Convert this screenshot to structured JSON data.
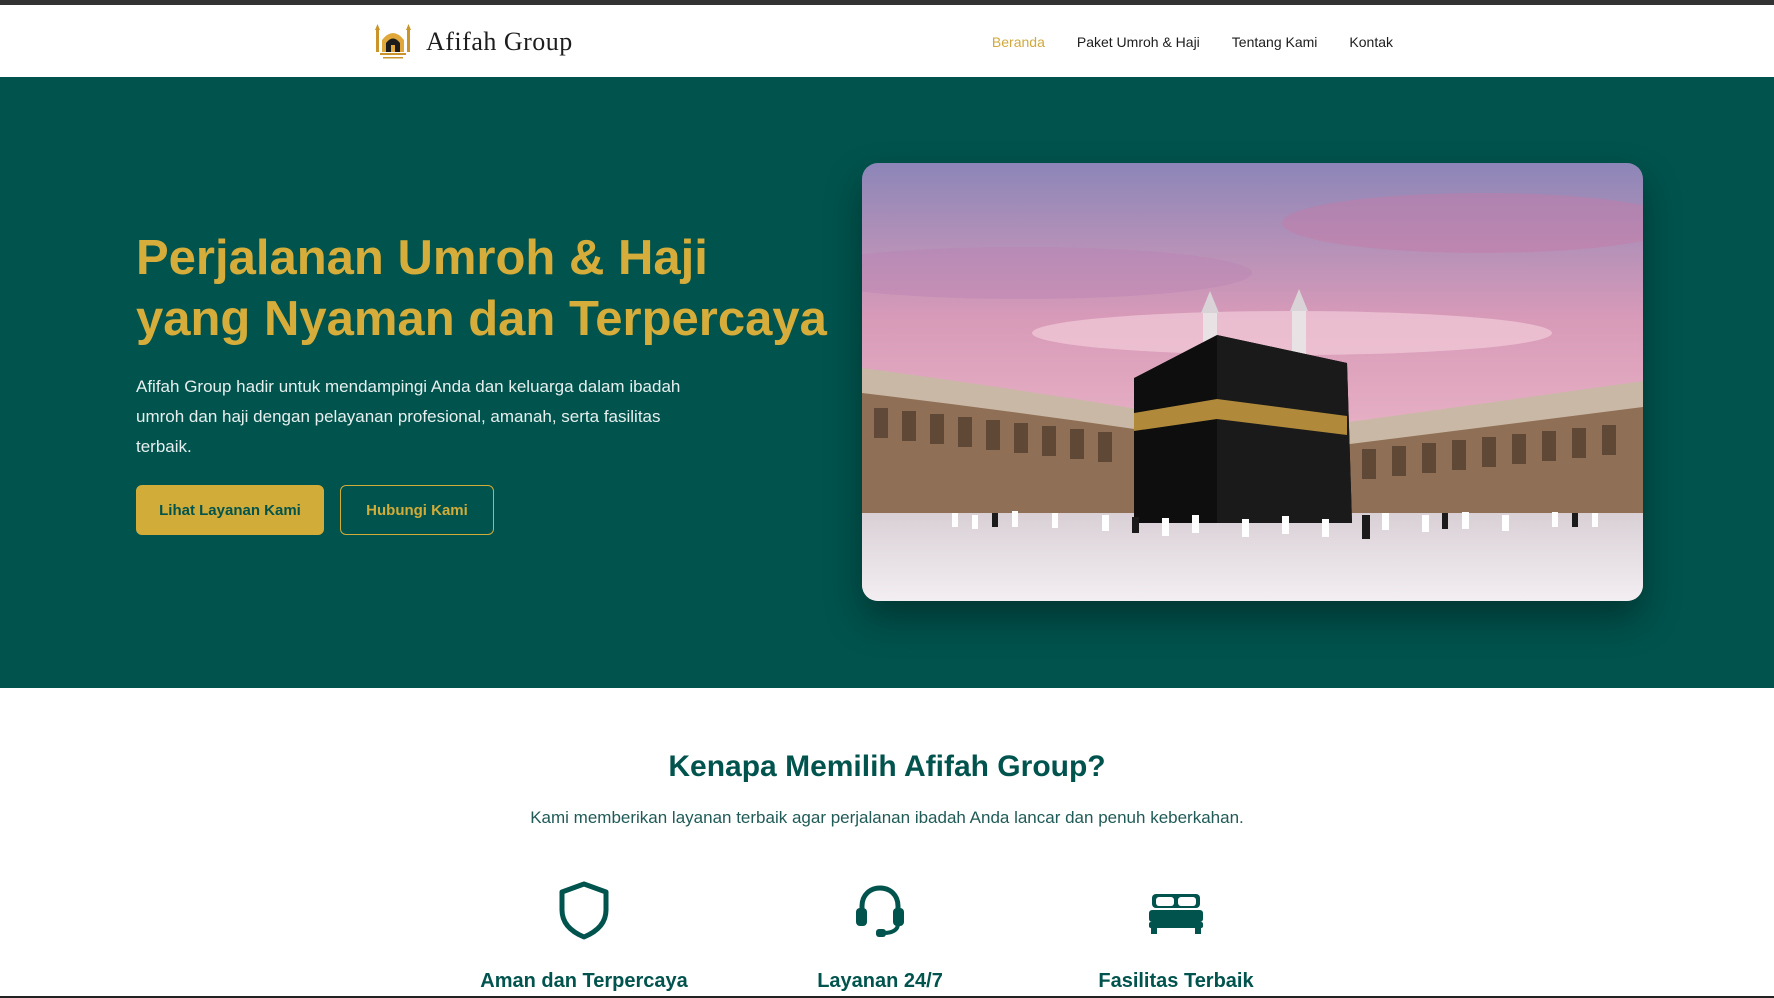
{
  "brand": {
    "name": "Afifah Group",
    "logo_icon": "mosque-logo-icon"
  },
  "nav": {
    "items": [
      {
        "label": "Beranda",
        "active": true
      },
      {
        "label": "Paket Umroh & Haji",
        "active": false
      },
      {
        "label": "Tentang Kami",
        "active": false
      },
      {
        "label": "Kontak",
        "active": false
      }
    ]
  },
  "hero": {
    "title_line1": "Perjalanan Umroh & Haji",
    "title_line2": "yang Nyaman dan Terpercaya",
    "description": "Afifah Group hadir untuk mendampingi Anda dan keluarga dalam ibadah umroh dan haji dengan pelayanan profesional, amanah, serta fasilitas terbaik.",
    "primary_button": "Lihat Layanan Kami",
    "secondary_button": "Hubungi Kami",
    "image_icon": "kaaba-photo"
  },
  "why": {
    "title": "Kenapa Memilih Afifah Group?",
    "subtitle": "Kami memberikan layanan terbaik agar perjalanan ibadah Anda lancar dan penuh keberkahan.",
    "features": [
      {
        "label": "Aman dan Terpercaya",
        "icon": "shield-icon"
      },
      {
        "label": "Layanan 24/7",
        "icon": "headset-icon"
      },
      {
        "label": "Fasilitas Terbaik",
        "icon": "bed-icon"
      }
    ]
  },
  "colors": {
    "primary_green": "#01534d",
    "gold": "#d2ac38",
    "white": "#ffffff"
  }
}
